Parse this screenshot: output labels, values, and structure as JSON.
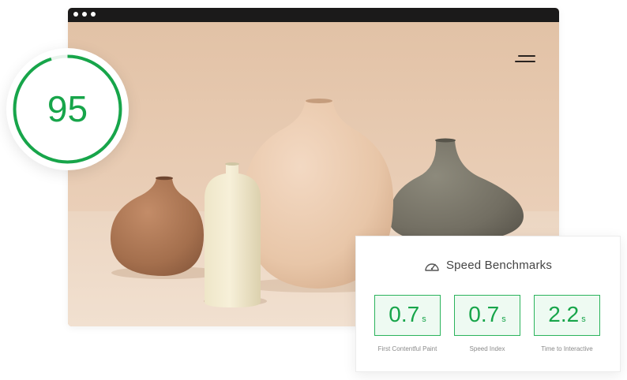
{
  "score": {
    "value": "95",
    "fraction": 0.95,
    "color": "#17a54a"
  },
  "hero": {
    "menu_icon": "hamburger-menu-icon"
  },
  "benchmarks": {
    "icon": "speedometer-icon",
    "title": "Speed Benchmarks",
    "accent": "#17a54a",
    "metrics": [
      {
        "value": "0.7",
        "unit": "s",
        "label": "First Contentful Paint"
      },
      {
        "value": "0.7",
        "unit": "s",
        "label": "Speed Index"
      },
      {
        "value": "2.2",
        "unit": "s",
        "label": "Time to Interactive"
      }
    ]
  }
}
